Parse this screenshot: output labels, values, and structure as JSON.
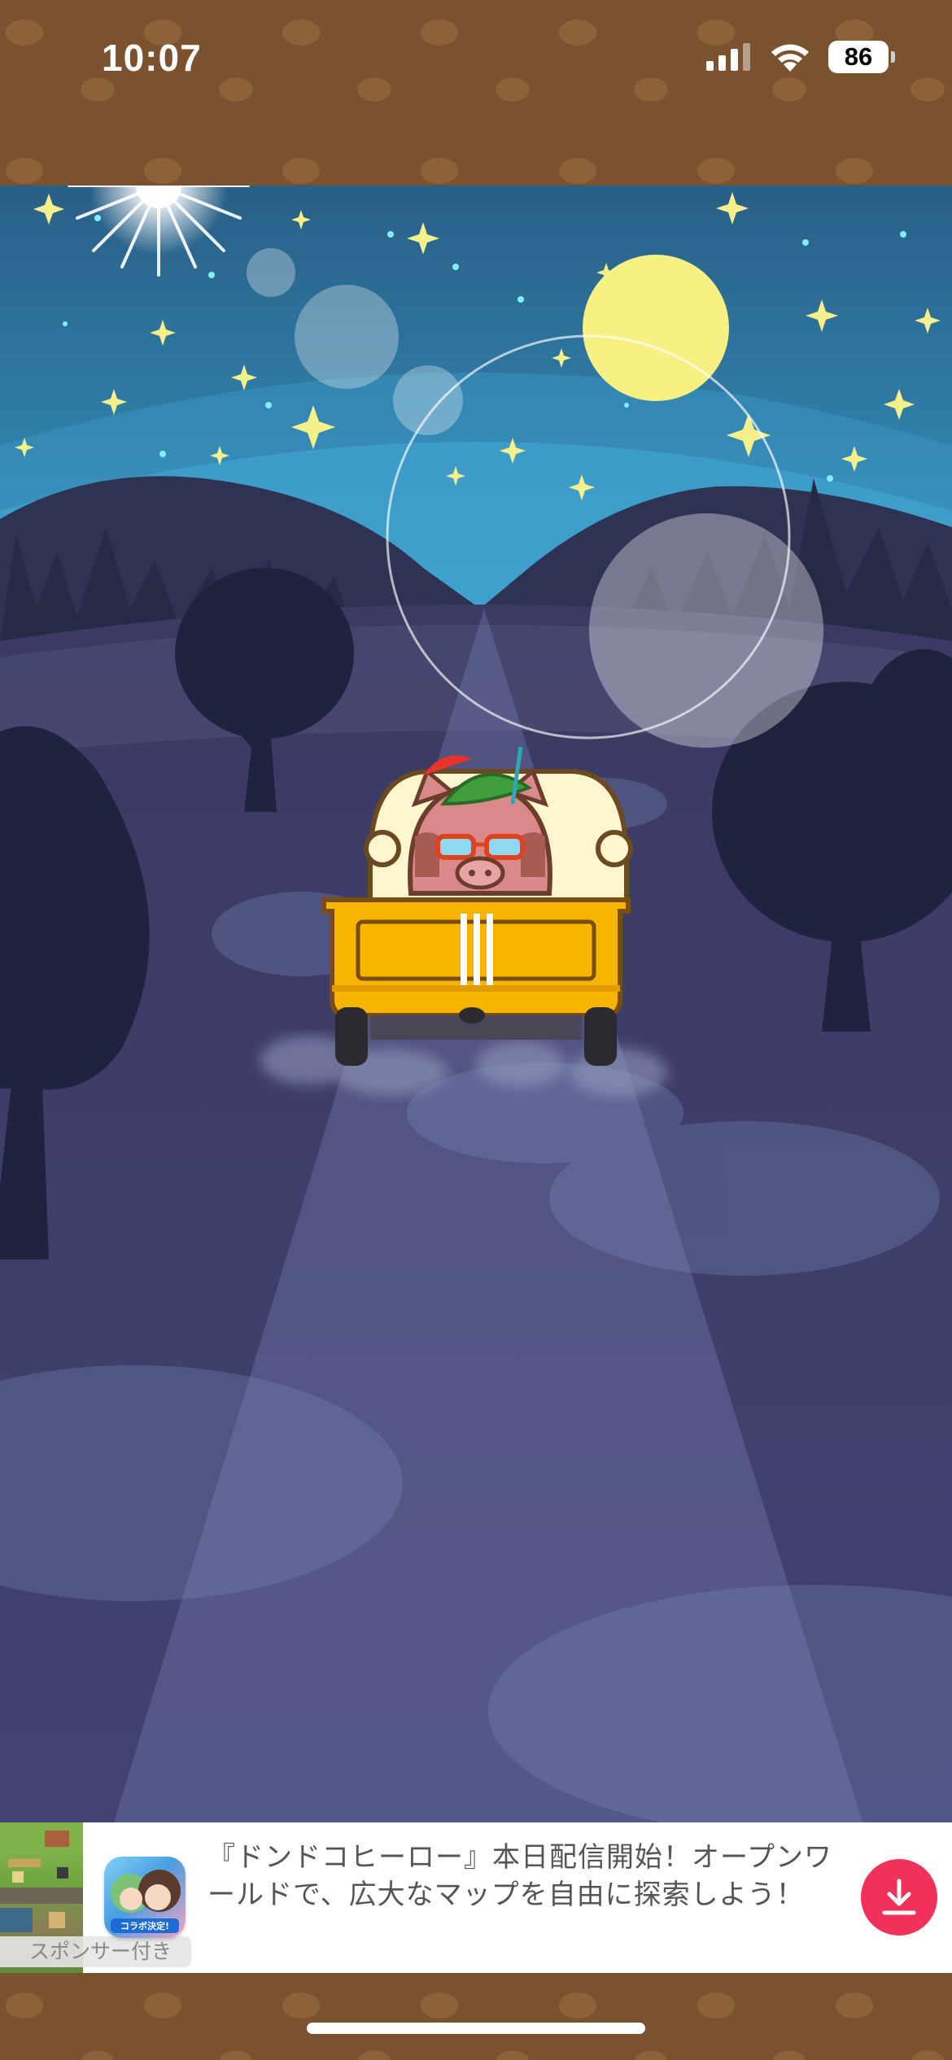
{
  "status_bar": {
    "time": "10:07",
    "battery_level": "86",
    "icons": [
      "signal-icon",
      "wifi-icon",
      "battery-icon"
    ]
  },
  "game": {
    "scene": "night-road",
    "character": "boar-driving-truck",
    "truck_color": "#f7b500",
    "sky_colors": [
      "#2c6b8e",
      "#3fa8d0"
    ],
    "moon_color": "#f7f184"
  },
  "ad": {
    "text": "『ドンドコヒーロー』本日配信開始！オープンワールドで、広大なマップを自由に探索しよう！",
    "sponsor_label": "スポンサー付き",
    "icon_badge": "コラボ決定!",
    "download_icon": "download-icon",
    "accent_color": "#f0325a"
  }
}
